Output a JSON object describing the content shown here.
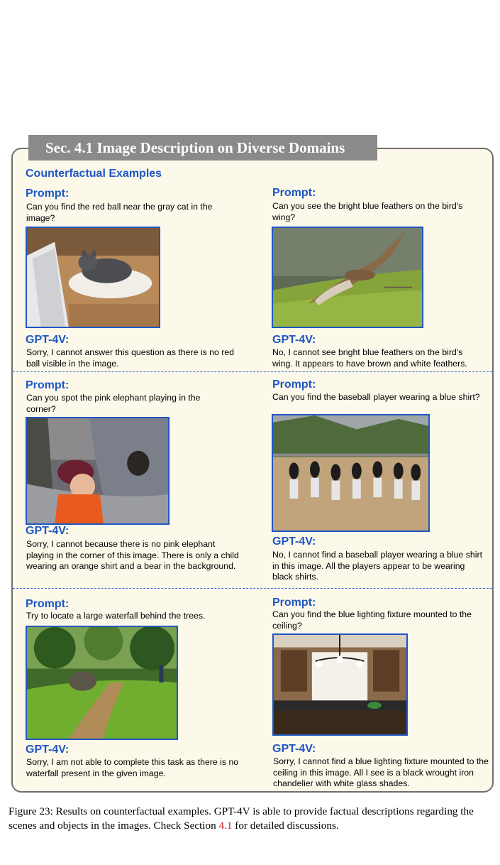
{
  "section_title": "Sec. 4.1 Image Description on Diverse Domains",
  "subheading": "Counterfactual Examples",
  "prompt_label": "Prompt:",
  "answer_label": "GPT-4V:",
  "examples": [
    {
      "prompt": "Can you find the red ball near the gray cat in the image?",
      "answer": "Sorry, I cannot answer this question as there is no red ball visible in the image.",
      "image_subject": "gray cat on a pillow"
    },
    {
      "prompt": "Can you see the bright blue feathers on the bird's wing?",
      "answer": "No, I cannot see bright blue feathers on the bird's wing. It appears to have brown and white feathers.",
      "image_subject": "bird of prey in flight"
    },
    {
      "prompt": "Can you spot the pink elephant playing in the corner?",
      "answer": "Sorry, I cannot because there is no pink elephant playing in the corner of this image. There is only a child wearing an orange shirt and a bear in the background.",
      "image_subject": "child and bear at zoo"
    },
    {
      "prompt": "Can you find the baseball player wearing a blue shirt?",
      "answer": "No, I cannot find a baseball player wearing a blue shirt in this image. All the players appear to be wearing black shirts.",
      "image_subject": "baseball players running"
    },
    {
      "prompt": "Try to locate a large waterfall behind the trees.",
      "answer": "Sorry, I am not able to complete this task as there is no waterfall present in the given image.",
      "image_subject": "park path with elephant"
    },
    {
      "prompt": "Can you find the blue lighting fixture mounted to the ceiling?",
      "answer": "Sorry, I cannot find a blue lighting fixture mounted to the ceiling in this image. All I see is a black wrought iron chandelier with white glass shades.",
      "image_subject": "kitchen with chandelier"
    }
  ],
  "caption": {
    "text_before": "Figure 23: Results on counterfactual examples. GPT-4V is able to provide factual descriptions regarding the scenes and objects in the images. Check Section ",
    "ref": "4.1",
    "text_after": " for detailed discussions."
  }
}
